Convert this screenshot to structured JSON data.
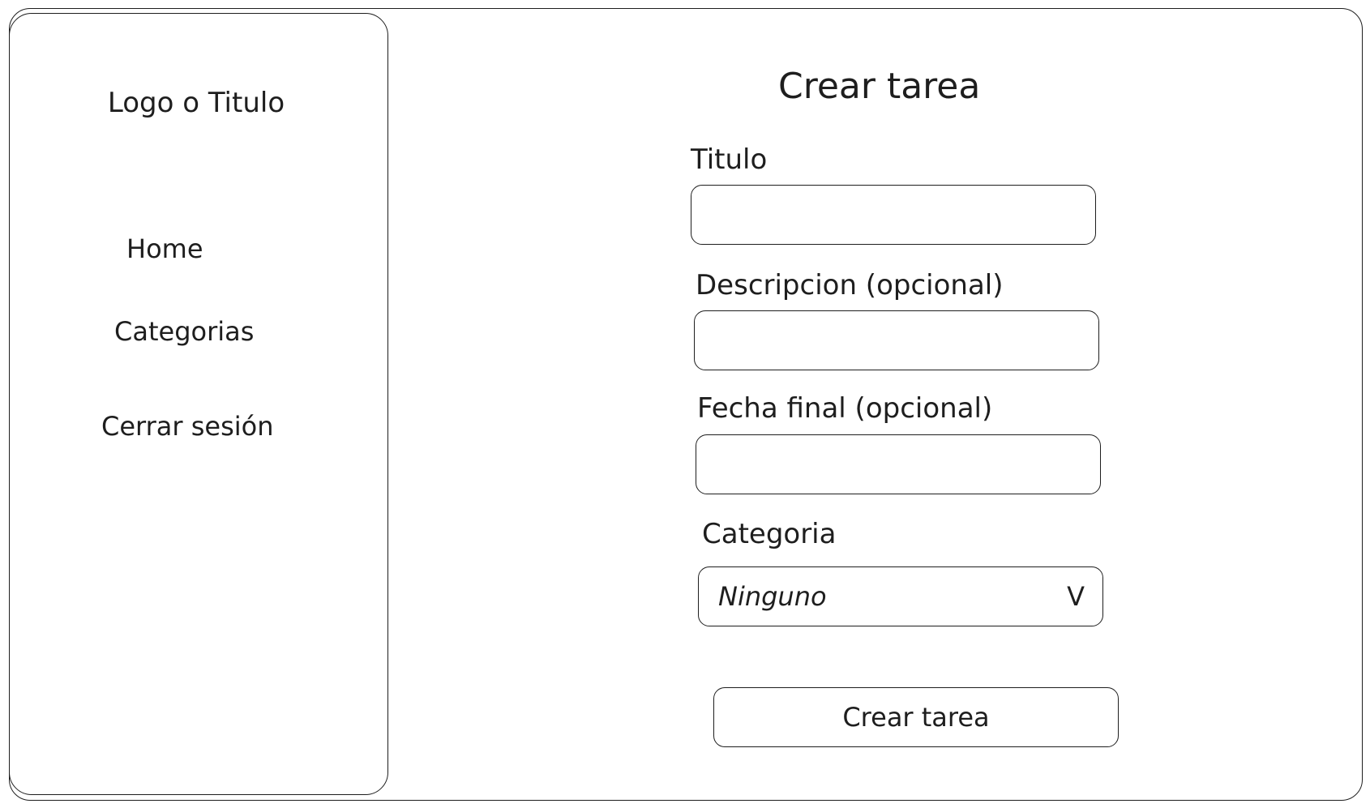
{
  "sidebar": {
    "logo_text": "Logo o Titulo",
    "items": [
      {
        "label": "Home"
      },
      {
        "label": "Categorias"
      },
      {
        "label": "Cerrar sesión"
      }
    ]
  },
  "form": {
    "title": "Crear tarea",
    "fields": {
      "titulo": {
        "label": "Titulo",
        "value": ""
      },
      "descripcion": {
        "label": "Descripcion (opcional)",
        "value": ""
      },
      "fecha_final": {
        "label": "Fecha final (opcional)",
        "value": ""
      },
      "categoria": {
        "label": "Categoria",
        "selected": "Ninguno",
        "arrow": "V"
      }
    },
    "submit_label": "Crear tarea"
  }
}
